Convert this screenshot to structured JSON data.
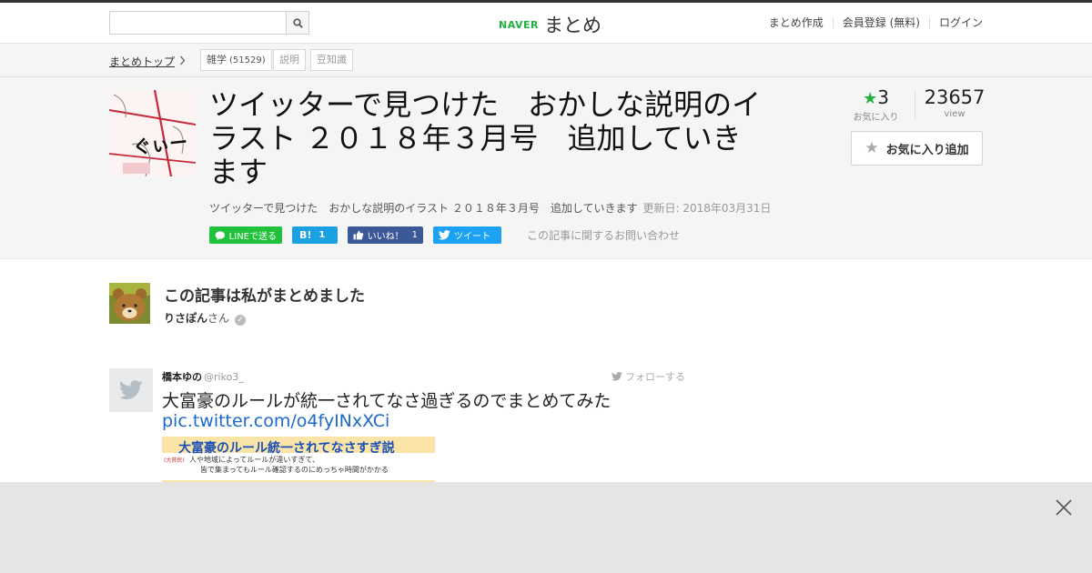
{
  "header": {
    "search_placeholder": "",
    "logo_brand": "NAVER",
    "logo_service": "まとめ",
    "links": [
      "まとめ作成",
      "会員登録 (無料)",
      "ログイン"
    ]
  },
  "breadcrumb": {
    "home": "まとめトップ",
    "tags": [
      {
        "label": "雑学",
        "count": "(51529)"
      },
      {
        "label": "説明"
      },
      {
        "label": "豆知識"
      }
    ]
  },
  "article": {
    "title": "ツイッターで見つけた　おかしな説明のイラスト ２０１８年３月号　追加していきます",
    "description": "ツイッターで見つけた　おかしな説明のイラスト ２０１８年３月号　追加していきます",
    "updated": "更新日: 2018年03月31日",
    "favorites": "3",
    "favorites_label": "お気に入り",
    "views": "23657",
    "views_label": "view",
    "fav_button": "お気に入り追加",
    "thumb_text": "ぐぃー"
  },
  "share": {
    "line": "LINEで送る",
    "hatena_mark": "B!",
    "hatena_count": "1",
    "facebook": "いいね！",
    "facebook_count": "1",
    "twitter": "ツイート",
    "inquiry": "この記事に関するお問い合わせ"
  },
  "author": {
    "heading": "この記事は私がまとめました",
    "name": "りさぽんさん",
    "suffix": "さん"
  },
  "tweet": {
    "user_name": "橋本ゆの",
    "handle": "@riko3_",
    "follow": "フォローする",
    "text": "大富豪のルールが統一されてなさ過ぎるのでまとめてみた",
    "link": "pic.twitter.com/o4fyINxXCi",
    "image_title": "大富豪のルール統一されてなさすぎ説",
    "image_line1": "人や地域によってルールが違いすぎて、",
    "image_line2": "皆で集まってもルール確認するのにめっちゃ時間がかかる",
    "image_side": "(大貧民)"
  },
  "colors": {
    "naver_green": "#1fb23e",
    "line_green": "#1fc23a",
    "hatena_blue": "#1ba1e2",
    "facebook_blue": "#3b5998",
    "twitter_blue": "#1da1f2",
    "link_blue": "#1b6ac9"
  }
}
